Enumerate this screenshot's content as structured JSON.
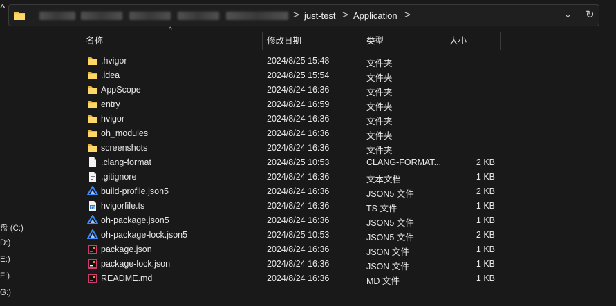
{
  "address_bar": {
    "path": [
      "just-test",
      "Application"
    ],
    "separator": ">",
    "dropdown_glyph": "⌄",
    "refresh_glyph": "↻",
    "up_glyph": "^"
  },
  "nav_pane": {
    "fragments": [
      "盘 (C:)",
      "D:)",
      "E:)",
      "F:)",
      "G:)"
    ]
  },
  "columns": {
    "name": "名称",
    "modified": "修改日期",
    "type": "类型",
    "size": "大小"
  },
  "files": [
    {
      "name": ".hvigor",
      "date": "2024/8/25 15:48",
      "type": "文件夹",
      "size": "",
      "icon": "folder-icon"
    },
    {
      "name": ".idea",
      "date": "2024/8/25 15:54",
      "type": "文件夹",
      "size": "",
      "icon": "folder-icon"
    },
    {
      "name": "AppScope",
      "date": "2024/8/24 16:36",
      "type": "文件夹",
      "size": "",
      "icon": "folder-icon"
    },
    {
      "name": "entry",
      "date": "2024/8/24 16:59",
      "type": "文件夹",
      "size": "",
      "icon": "folder-icon"
    },
    {
      "name": "hvigor",
      "date": "2024/8/24 16:36",
      "type": "文件夹",
      "size": "",
      "icon": "folder-icon"
    },
    {
      "name": "oh_modules",
      "date": "2024/8/24 16:36",
      "type": "文件夹",
      "size": "",
      "icon": "folder-icon"
    },
    {
      "name": "screenshots",
      "date": "2024/8/24 16:36",
      "type": "文件夹",
      "size": "",
      "icon": "folder-icon"
    },
    {
      "name": ".clang-format",
      "date": "2024/8/25 10:53",
      "type": "CLANG-FORMAT...",
      "size": "2 KB",
      "icon": "blank-file-icon"
    },
    {
      "name": ".gitignore",
      "date": "2024/8/24 16:36",
      "type": "文本文档",
      "size": "1 KB",
      "icon": "text-file-icon"
    },
    {
      "name": "build-profile.json5",
      "date": "2024/8/24 16:36",
      "type": "JSON5 文件",
      "size": "2 KB",
      "icon": "json5-file-icon"
    },
    {
      "name": "hvigorfile.ts",
      "date": "2024/8/24 16:36",
      "type": "TS 文件",
      "size": "1 KB",
      "icon": "ts-file-icon"
    },
    {
      "name": "oh-package.json5",
      "date": "2024/8/24 16:36",
      "type": "JSON5 文件",
      "size": "1 KB",
      "icon": "json5-file-icon"
    },
    {
      "name": "oh-package-lock.json5",
      "date": "2024/8/25 10:53",
      "type": "JSON5 文件",
      "size": "2 KB",
      "icon": "json5-file-icon"
    },
    {
      "name": "package.json",
      "date": "2024/8/24 16:36",
      "type": "JSON 文件",
      "size": "1 KB",
      "icon": "jetbrains-file-icon"
    },
    {
      "name": "package-lock.json",
      "date": "2024/8/24 16:36",
      "type": "JSON 文件",
      "size": "1 KB",
      "icon": "jetbrains-file-icon"
    },
    {
      "name": "README.md",
      "date": "2024/8/24 16:36",
      "type": "MD 文件",
      "size": "1 KB",
      "icon": "jetbrains-file-icon"
    }
  ],
  "colors": {
    "background": "#191919",
    "text": "#e6e6e6",
    "folder": "#f2c14e",
    "json5": "#3d8bfd",
    "ts": "#3178c6"
  }
}
